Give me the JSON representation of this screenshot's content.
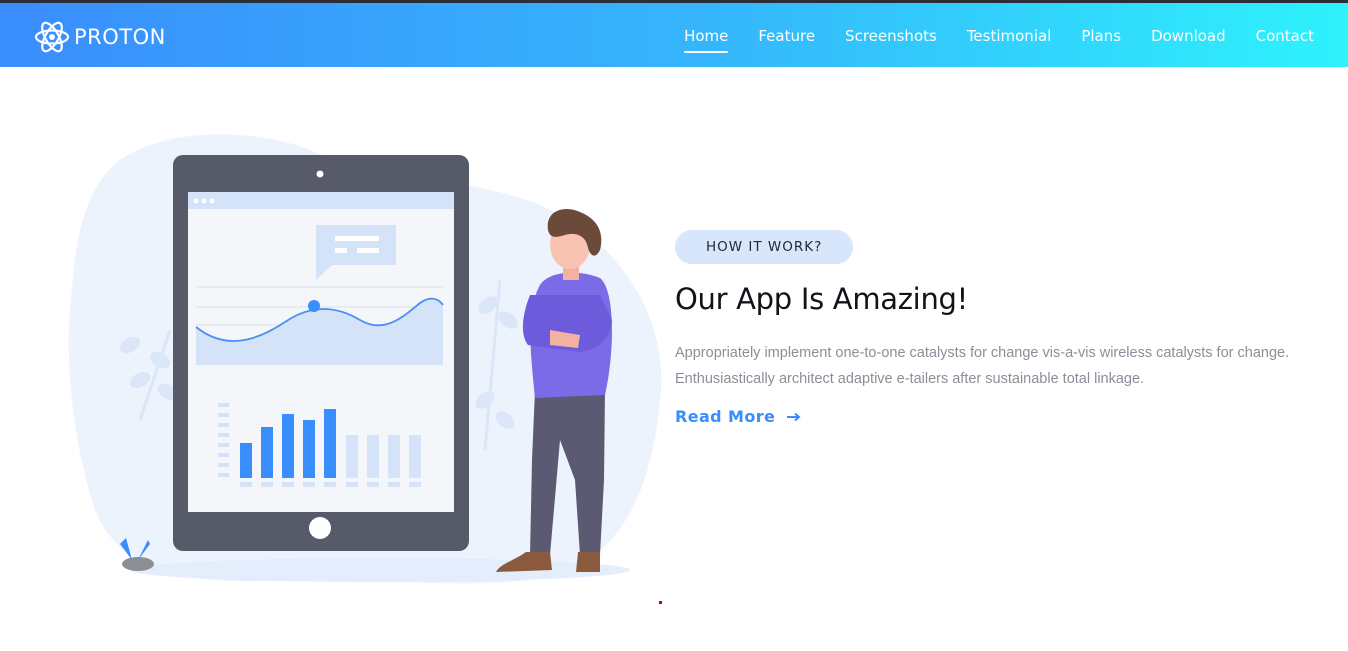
{
  "brand": {
    "name": "PROTON",
    "icon": "atom-icon"
  },
  "nav": {
    "items": [
      {
        "label": "Home",
        "active": true
      },
      {
        "label": "Feature",
        "active": false
      },
      {
        "label": "Screenshots",
        "active": false
      },
      {
        "label": "Testimonial",
        "active": false
      },
      {
        "label": "Plans",
        "active": false
      },
      {
        "label": "Download",
        "active": false
      },
      {
        "label": "Contact",
        "active": false
      }
    ]
  },
  "hero": {
    "badge": "HOW IT WORK?",
    "headline": "Our App Is Amazing!",
    "description": "Appropriately implement one-to-one catalysts for change vis-a-vis wireless catalysts for change. Enthusiastically architect adaptive e-tailers after sustainable total linkage.",
    "read_more": "Read More",
    "read_more_icon": "arrow-right-icon"
  },
  "colors": {
    "gradient_start": "#3a8dfc",
    "gradient_end": "#2ef2fc",
    "accent": "#3a8dfc",
    "badge_bg": "#d7e6fb"
  }
}
